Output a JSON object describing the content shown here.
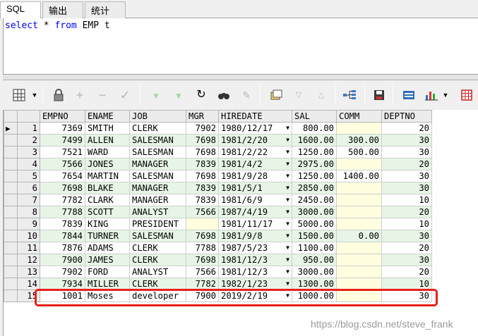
{
  "tabs": [
    "SQL",
    "输出",
    "统计"
  ],
  "sql": {
    "kw1": "select",
    "star": " * ",
    "kw2": "from",
    "rest": " EMP t"
  },
  "columns": [
    "EMPNO",
    "ENAME",
    "JOB",
    "MGR",
    "HIREDATE",
    "SAL",
    "COMM",
    "DEPTNO"
  ],
  "rows": [
    {
      "rn": "1",
      "empno": "7369",
      "ename": "SMITH",
      "job": "CLERK",
      "mgr": "7902",
      "hiredate": "1980/12/17",
      "sal": "800.00",
      "comm": "",
      "deptno": "20"
    },
    {
      "rn": "2",
      "empno": "7499",
      "ename": "ALLEN",
      "job": "SALESMAN",
      "mgr": "7698",
      "hiredate": "1981/2/20",
      "sal": "1600.00",
      "comm": "300.00",
      "deptno": "30"
    },
    {
      "rn": "3",
      "empno": "7521",
      "ename": "WARD",
      "job": "SALESMAN",
      "mgr": "7698",
      "hiredate": "1981/2/22",
      "sal": "1250.00",
      "comm": "500.00",
      "deptno": "30"
    },
    {
      "rn": "4",
      "empno": "7566",
      "ename": "JONES",
      "job": "MANAGER",
      "mgr": "7839",
      "hiredate": "1981/4/2",
      "sal": "2975.00",
      "comm": "",
      "deptno": "20"
    },
    {
      "rn": "5",
      "empno": "7654",
      "ename": "MARTIN",
      "job": "SALESMAN",
      "mgr": "7698",
      "hiredate": "1981/9/28",
      "sal": "1250.00",
      "comm": "1400.00",
      "deptno": "30"
    },
    {
      "rn": "6",
      "empno": "7698",
      "ename": "BLAKE",
      "job": "MANAGER",
      "mgr": "7839",
      "hiredate": "1981/5/1",
      "sal": "2850.00",
      "comm": "",
      "deptno": "30"
    },
    {
      "rn": "7",
      "empno": "7782",
      "ename": "CLARK",
      "job": "MANAGER",
      "mgr": "7839",
      "hiredate": "1981/6/9",
      "sal": "2450.00",
      "comm": "",
      "deptno": "10"
    },
    {
      "rn": "8",
      "empno": "7788",
      "ename": "SCOTT",
      "job": "ANALYST",
      "mgr": "7566",
      "hiredate": "1987/4/19",
      "sal": "3000.00",
      "comm": "",
      "deptno": "20"
    },
    {
      "rn": "9",
      "empno": "7839",
      "ename": "KING",
      "job": "PRESIDENT",
      "mgr": "",
      "hiredate": "1981/11/17",
      "sal": "5000.00",
      "comm": "",
      "deptno": "10"
    },
    {
      "rn": "10",
      "empno": "7844",
      "ename": "TURNER",
      "job": "SALESMAN",
      "mgr": "7698",
      "hiredate": "1981/9/8",
      "sal": "1500.00",
      "comm": "0.00",
      "deptno": "30"
    },
    {
      "rn": "11",
      "empno": "7876",
      "ename": "ADAMS",
      "job": "CLERK",
      "mgr": "7788",
      "hiredate": "1987/5/23",
      "sal": "1100.00",
      "comm": "",
      "deptno": "20"
    },
    {
      "rn": "12",
      "empno": "7900",
      "ename": "JAMES",
      "job": "CLERK",
      "mgr": "7698",
      "hiredate": "1981/12/3",
      "sal": "950.00",
      "comm": "",
      "deptno": "30"
    },
    {
      "rn": "13",
      "empno": "7902",
      "ename": "FORD",
      "job": "ANALYST",
      "mgr": "7566",
      "hiredate": "1981/12/3",
      "sal": "3000.00",
      "comm": "",
      "deptno": "20"
    },
    {
      "rn": "14",
      "empno": "7934",
      "ename": "MILLER",
      "job": "CLERK",
      "mgr": "7782",
      "hiredate": "1982/1/23",
      "sal": "1300.00",
      "comm": "",
      "deptno": "10"
    },
    {
      "rn": "15",
      "empno": "1001",
      "ename": "Moses",
      "job": "developer",
      "mgr": "7900",
      "hiredate": "2019/2/19",
      "sal": "1000.00",
      "comm": "",
      "deptno": "30"
    }
  ],
  "watermark": "https://blog.csdn.net/steve_frank",
  "colors": {
    "row_alt": "#e6f5e6",
    "null_cell": "#ffffe0",
    "highlight": "#e8201a",
    "keyword": "#0000ff"
  }
}
